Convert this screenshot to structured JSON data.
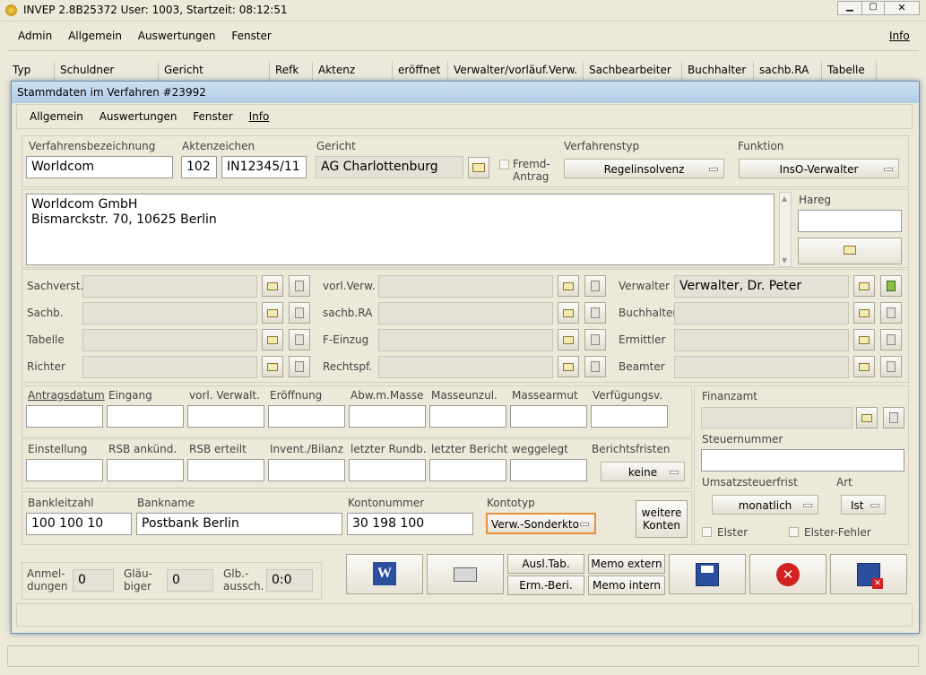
{
  "app": {
    "title": "INVEP 2.8B25372 User: 1003, Startzeit: 08:12:51"
  },
  "main_menu": [
    "Admin",
    "Allgemein",
    "Auswertungen",
    "Fenster"
  ],
  "main_menu_info": "Info",
  "table_headers": [
    "Typ",
    "Schuldner",
    "Gericht",
    "Refk",
    "Aktenz",
    "eröffnet",
    "Verwalter/vorläuf.Verw.",
    "Sachbearbeiter",
    "Buchhalter",
    "sachb.RA",
    "Tabelle"
  ],
  "dialog": {
    "title": "Stammdaten im Verfahren #23992",
    "menu": [
      "Allgemein",
      "Auswertungen",
      "Fenster"
    ],
    "menu_info": "Info"
  },
  "row1": {
    "verfahrensbezeichnung_label": "Verfahrensbezeichnung",
    "verfahrensbezeichnung": "Worldcom",
    "aktenzeichen_label": "Aktenzeichen",
    "aktenzeichen_nr": "102",
    "aktenzeichen": "IN12345/11",
    "gericht_label": "Gericht",
    "gericht": "AG Charlottenburg",
    "fremd_antrag_line1": "Fremd-",
    "fremd_antrag_line2": "Antrag",
    "verfahrenstyp_label": "Verfahrenstyp",
    "verfahrenstyp": "Regelinsolvenz",
    "funktion_label": "Funktion",
    "funktion": "InsO-Verwalter"
  },
  "address": {
    "line1": "Worldcom GmbH",
    "line2": "Bismarckstr. 70, 10625 Berlin",
    "hareg_label": "Hareg"
  },
  "persons": {
    "col1": [
      "Sachverst.",
      "Sachb.",
      "Tabelle",
      "Richter"
    ],
    "col2": [
      "vorl.Verw.",
      "sachb.RA",
      "F-Einzug",
      "Rechtspf."
    ],
    "col3": [
      "Verwalter",
      "Buchhalter",
      "Ermittler",
      "Beamter"
    ],
    "verwalter_value": "Verwalter, Dr. Peter"
  },
  "dates1": [
    "Antragsdatum",
    "Eingang",
    "vorl. Verwalt.",
    "Eröffnung",
    "Abw.m.Masse",
    "Masseunzul.",
    "Massearmut",
    "Verfügungsv."
  ],
  "dates2": [
    "Einstellung",
    "RSB ankünd.",
    "RSB erteilt",
    "Invent./Bilanz",
    "letzter Rundb.",
    "letzter Bericht",
    "weggelegt"
  ],
  "berichtsfristen_label": "Berichtsfristen",
  "berichtsfristen": "keine",
  "tax": {
    "finanzamt_label": "Finanzamt",
    "steuernummer_label": "Steuernummer",
    "ust_frist_label": "Umsatzsteuerfrist",
    "ust_frist": "monatlich",
    "art_label": "Art",
    "art": "Ist",
    "elster": "Elster",
    "elster_fehler": "Elster-Fehler"
  },
  "bank": {
    "blz_label": "Bankleitzahl",
    "blz": "100 100 10",
    "bankname_label": "Bankname",
    "bankname": "Postbank Berlin",
    "konto_label": "Kontonummer",
    "konto": "30 198 100",
    "kontotyp_label": "Kontotyp",
    "kontotyp": "Verw.-Sonderkto",
    "weitere_line1": "weitere",
    "weitere_line2": "Konten"
  },
  "counters": {
    "anmeldungen_line1": "Anmel-",
    "anmeldungen_line2": "dungen",
    "anmeldungen": "0",
    "glaeubiger_line1": "Gläu-",
    "glaeubiger_line2": "biger",
    "glaeubiger": "0",
    "glb_line1": "Glb.-",
    "glb_line2": "aussch.",
    "glb": "0:0"
  },
  "actions": {
    "ausl_tab": "Ausl.Tab.",
    "erm_beri": "Erm.-Beri.",
    "memo_extern": "Memo extern",
    "memo_intern": "Memo intern"
  },
  "colors": {
    "accent_orange": "#e8903a",
    "close_red": "#d42020",
    "save_blue": "#2b4f9e"
  }
}
